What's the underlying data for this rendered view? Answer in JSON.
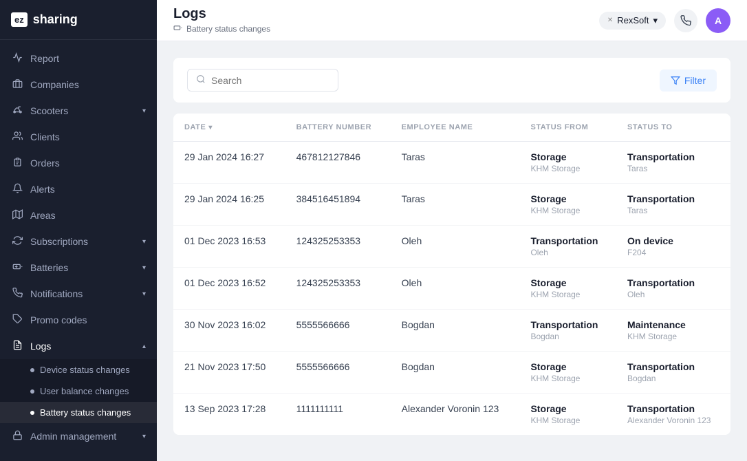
{
  "app": {
    "logo_box": "ez",
    "logo_text": "sharing"
  },
  "sidebar": {
    "items": [
      {
        "id": "report",
        "label": "Report",
        "icon": "📊",
        "has_sub": false,
        "active": false
      },
      {
        "id": "companies",
        "label": "Companies",
        "icon": "🏢",
        "has_sub": false,
        "active": false
      },
      {
        "id": "scooters",
        "label": "Scooters",
        "icon": "🛴",
        "has_sub": true,
        "active": false
      },
      {
        "id": "clients",
        "label": "Clients",
        "icon": "👤",
        "has_sub": false,
        "active": false
      },
      {
        "id": "orders",
        "label": "Orders",
        "icon": "📋",
        "has_sub": false,
        "active": false
      },
      {
        "id": "alerts",
        "label": "Alerts",
        "icon": "🔔",
        "has_sub": false,
        "active": false
      },
      {
        "id": "areas",
        "label": "Areas",
        "icon": "📍",
        "has_sub": false,
        "active": false
      },
      {
        "id": "subscriptions",
        "label": "Subscriptions",
        "icon": "🔄",
        "has_sub": true,
        "active": false
      },
      {
        "id": "batteries",
        "label": "Batteries",
        "icon": "🔋",
        "has_sub": true,
        "active": false
      },
      {
        "id": "notifications",
        "label": "Notifications",
        "icon": "📣",
        "has_sub": true,
        "active": false
      },
      {
        "id": "promo_codes",
        "label": "Promo codes",
        "icon": "🏷️",
        "has_sub": false,
        "active": false
      },
      {
        "id": "logs",
        "label": "Logs",
        "icon": "📝",
        "has_sub": true,
        "active": true
      },
      {
        "id": "admin",
        "label": "Admin management",
        "icon": "🔒",
        "has_sub": true,
        "active": false
      }
    ],
    "logs_sub": [
      {
        "id": "device_status",
        "label": "Device status changes",
        "active": false
      },
      {
        "id": "user_balance",
        "label": "User balance changes",
        "active": false
      },
      {
        "id": "battery_status",
        "label": "Battery status changes",
        "active": true
      }
    ]
  },
  "topbar": {
    "title": "Logs",
    "breadcrumb_icon": "🔋",
    "breadcrumb_text": "Battery status changes",
    "org_name": "RexSoft"
  },
  "toolbar": {
    "search_placeholder": "Search",
    "filter_label": "Filter"
  },
  "table": {
    "columns": [
      "DATE",
      "BATTERY NUMBER",
      "EMPLOYEE NAME",
      "STATUS FROM",
      "STATUS TO"
    ],
    "rows": [
      {
        "date": "29 Jan 2024 16:27",
        "battery_number": "467812127846",
        "employee_name": "Taras",
        "status_from_main": "Storage",
        "status_from_sub": "KHM Storage",
        "status_to_main": "Transportation",
        "status_to_sub": "Taras"
      },
      {
        "date": "29 Jan 2024 16:25",
        "battery_number": "384516451894",
        "employee_name": "Taras",
        "status_from_main": "Storage",
        "status_from_sub": "KHM Storage",
        "status_to_main": "Transportation",
        "status_to_sub": "Taras"
      },
      {
        "date": "01 Dec 2023 16:53",
        "battery_number": "124325253353",
        "employee_name": "Oleh",
        "status_from_main": "Transportation",
        "status_from_sub": "Oleh",
        "status_to_main": "On device",
        "status_to_sub": "F204"
      },
      {
        "date": "01 Dec 2023 16:52",
        "battery_number": "124325253353",
        "employee_name": "Oleh",
        "status_from_main": "Storage",
        "status_from_sub": "KHM Storage",
        "status_to_main": "Transportation",
        "status_to_sub": "Oleh"
      },
      {
        "date": "30 Nov 2023 16:02",
        "battery_number": "5555566666",
        "employee_name": "Bogdan",
        "status_from_main": "Transportation",
        "status_from_sub": "Bogdan",
        "status_to_main": "Maintenance",
        "status_to_sub": "KHM Storage"
      },
      {
        "date": "21 Nov 2023 17:50",
        "battery_number": "5555566666",
        "employee_name": "Bogdan",
        "status_from_main": "Storage",
        "status_from_sub": "KHM Storage",
        "status_to_main": "Transportation",
        "status_to_sub": "Bogdan"
      },
      {
        "date": "13 Sep 2023 17:28",
        "battery_number": "1111111111",
        "employee_name": "Alexander Voronin 123",
        "status_from_main": "Storage",
        "status_from_sub": "KHM Storage",
        "status_to_main": "Transportation",
        "status_to_sub": "Alexander Voronin 123"
      }
    ]
  }
}
